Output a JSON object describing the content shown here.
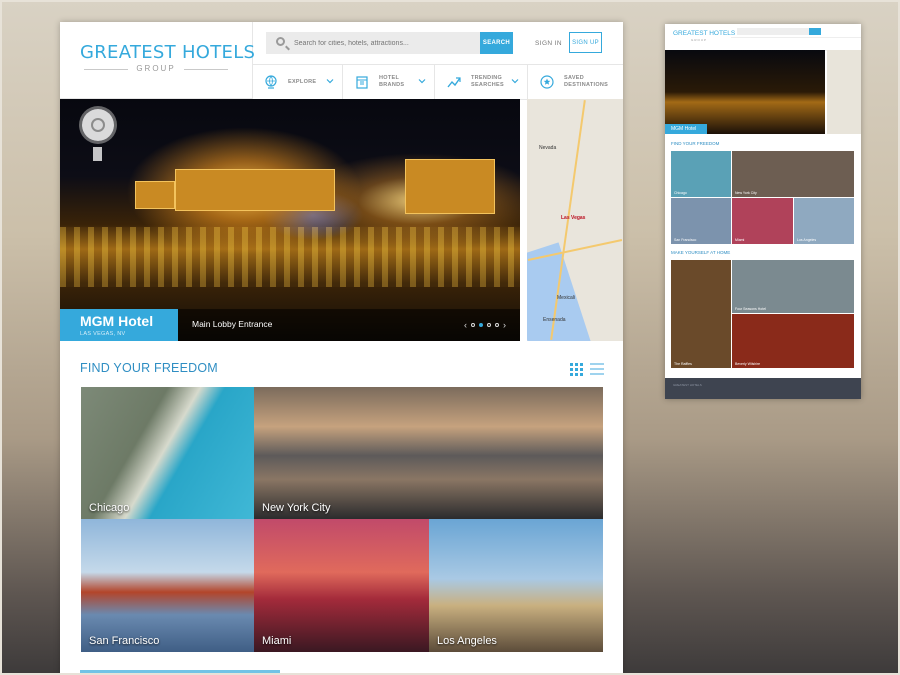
{
  "brand": {
    "name": "GREATEST HOTELS",
    "sub": "GROUP"
  },
  "search": {
    "placeholder": "Search for cities, hotels, attractions...",
    "button": "SEARCH"
  },
  "auth": {
    "signin": "SIGN IN",
    "signup": "SIGN UP"
  },
  "nav": [
    {
      "label": "EXPLORE",
      "icon": "globe-icon",
      "has_dropdown": true
    },
    {
      "label": "HOTEL\nBRANDS",
      "icon": "building-icon",
      "has_dropdown": true
    },
    {
      "label": "TRENDING\nSEARCHES",
      "icon": "trending-icon",
      "has_dropdown": true
    },
    {
      "label": "SAVED\nDESTINATIONS",
      "icon": "star-icon",
      "has_dropdown": false
    }
  ],
  "hero": {
    "title": "MGM Hotel",
    "location": "LAS VEGAS, NV",
    "caption": "Main Lobby Entrance",
    "slides": 4,
    "active_slide": 2
  },
  "map": {
    "labels": [
      "Nevada",
      "Las Vegas",
      "Mexicali",
      "Ensenada"
    ]
  },
  "freedom": {
    "title": "FIND YOUR FREEDOM",
    "cities": [
      "Chicago",
      "New York City",
      "San Francisco",
      "Miami",
      "Los Angeles"
    ]
  },
  "mini": {
    "brand": "GREATEST HOTELS",
    "sub": "GROUP",
    "hero_title": "MGM Hotel",
    "section1": "FIND YOUR FREEDOM",
    "section2": "MAKE YOURSELF AT HOME",
    "cities": [
      "Chicago",
      "New York City",
      "San Francisco",
      "Miami",
      "Los Angeles"
    ],
    "hotels": [
      "Four Seasons Hotel",
      "The Raffles",
      "Beverly Wilshire"
    ],
    "footer_brand": "GREATEST HOTELS"
  },
  "colors": {
    "accent": "#35a9dc",
    "heading": "#2f8ec3"
  }
}
